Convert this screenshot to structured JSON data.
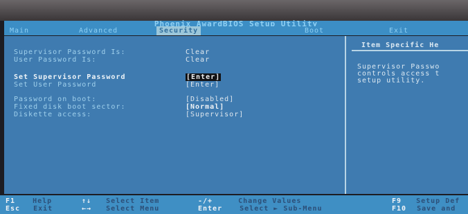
{
  "title": "Phoenix AwardBIOS Setup Utility",
  "menu": {
    "tabs": [
      {
        "label": "Main",
        "active": false
      },
      {
        "label": "Advanced",
        "active": false
      },
      {
        "label": "Security",
        "active": true
      },
      {
        "label": "Boot",
        "active": false
      },
      {
        "label": "Exit",
        "active": false
      }
    ]
  },
  "status": {
    "supervisor_label": "Supervisor Password Is:",
    "supervisor_value": "Clear",
    "user_label": "User Password Is:",
    "user_value": "Clear"
  },
  "items": {
    "set_supervisor_label": "Set Supervisor Password",
    "set_supervisor_value": "[Enter]",
    "set_user_label": "Set User Password",
    "set_user_value": "[Enter]",
    "password_on_boot_label": "Password on boot:",
    "password_on_boot_value": "[Disabled]",
    "fixed_disk_label": "Fixed disk boot sector:",
    "fixed_disk_value": "[Normal]",
    "diskette_label": "Diskette access:",
    "diskette_value": "[Supervisor]"
  },
  "help": {
    "header": "Item Specific He",
    "text": "Supervisor Passwo\ncontrols access t\nsetup utility."
  },
  "footer": {
    "f1_key": "F1",
    "f1_desc": "Help",
    "esc_key": "Esc",
    "esc_desc": "Exit",
    "updown_key": "↑↓",
    "updown_desc": "Select Item",
    "leftright_key": "←→",
    "leftright_desc": "Select Menu",
    "minusplus_key": "-/+",
    "minusplus_desc": "Change Values",
    "enter_key": "Enter",
    "enter_desc": "Select ► Sub-Menu",
    "f9_key": "F9",
    "f9_desc": "Setup Def",
    "f10_key": "F10",
    "f10_desc": "Save and"
  },
  "colors": {
    "background": "#3f7bb0",
    "title_bar": "#3c8ec5",
    "highlight": "#121214"
  }
}
